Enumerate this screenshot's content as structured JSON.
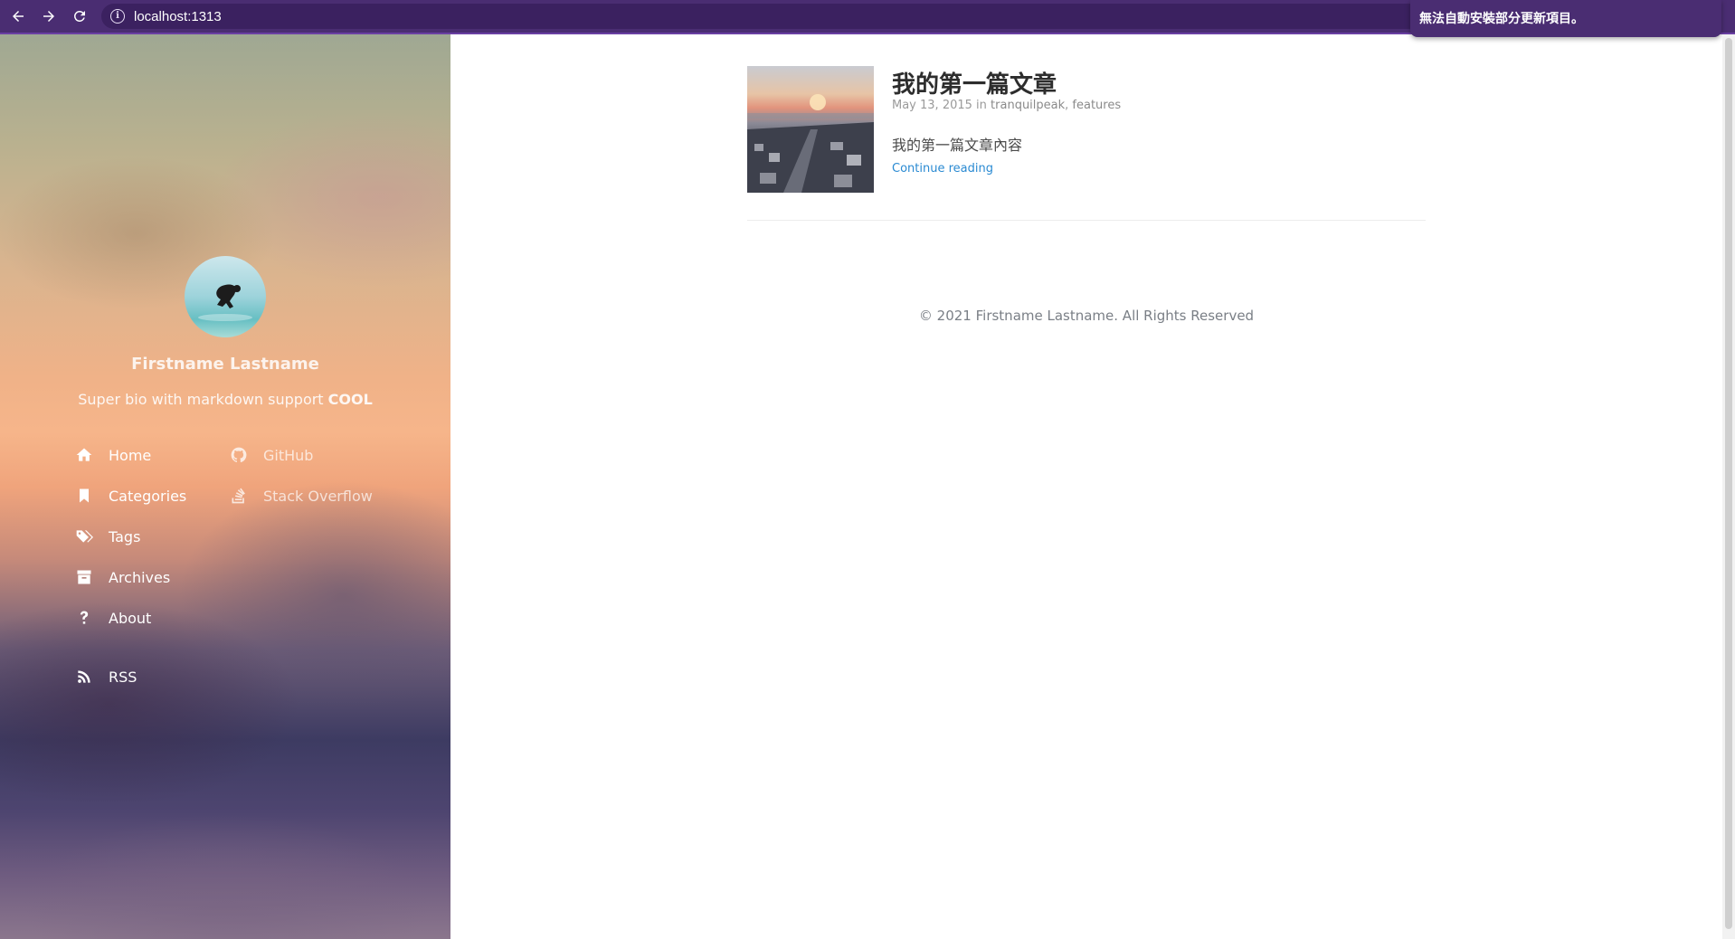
{
  "browser": {
    "url": "localhost:1313",
    "toast_message": "無法自動安裝部分更新項目。"
  },
  "sidebar": {
    "author_name": "Firstname Lastname",
    "bio_text": "Super bio with markdown support ",
    "bio_bold": "COOL",
    "menu": [
      {
        "label": "Home",
        "icon": "home-icon"
      },
      {
        "label": "Categories",
        "icon": "bookmark-icon"
      },
      {
        "label": "Tags",
        "icon": "tags-icon"
      },
      {
        "label": "Archives",
        "icon": "archive-icon"
      },
      {
        "label": "About",
        "icon": "question-icon"
      }
    ],
    "links": [
      {
        "label": "GitHub",
        "icon": "github-icon"
      },
      {
        "label": "Stack Overflow",
        "icon": "stack-overflow-icon"
      }
    ],
    "rss": {
      "label": "RSS",
      "icon": "rss-icon"
    }
  },
  "post": {
    "title": "我的第一篇文章",
    "date": "May 13, 2015",
    "in_word": "in",
    "category_1": "tranquilpeak",
    "category_2": "features",
    "excerpt": "我的第一篇文章內容",
    "continue_label": "Continue reading"
  },
  "footer": {
    "copyright": "© 2021 Firstname Lastname. All Rights Reserved"
  },
  "colors": {
    "browser_toolbar": "#4a2d72",
    "link": "#2a8ad2",
    "title": "#2d2d2d",
    "meta": "#9a9a9a"
  }
}
